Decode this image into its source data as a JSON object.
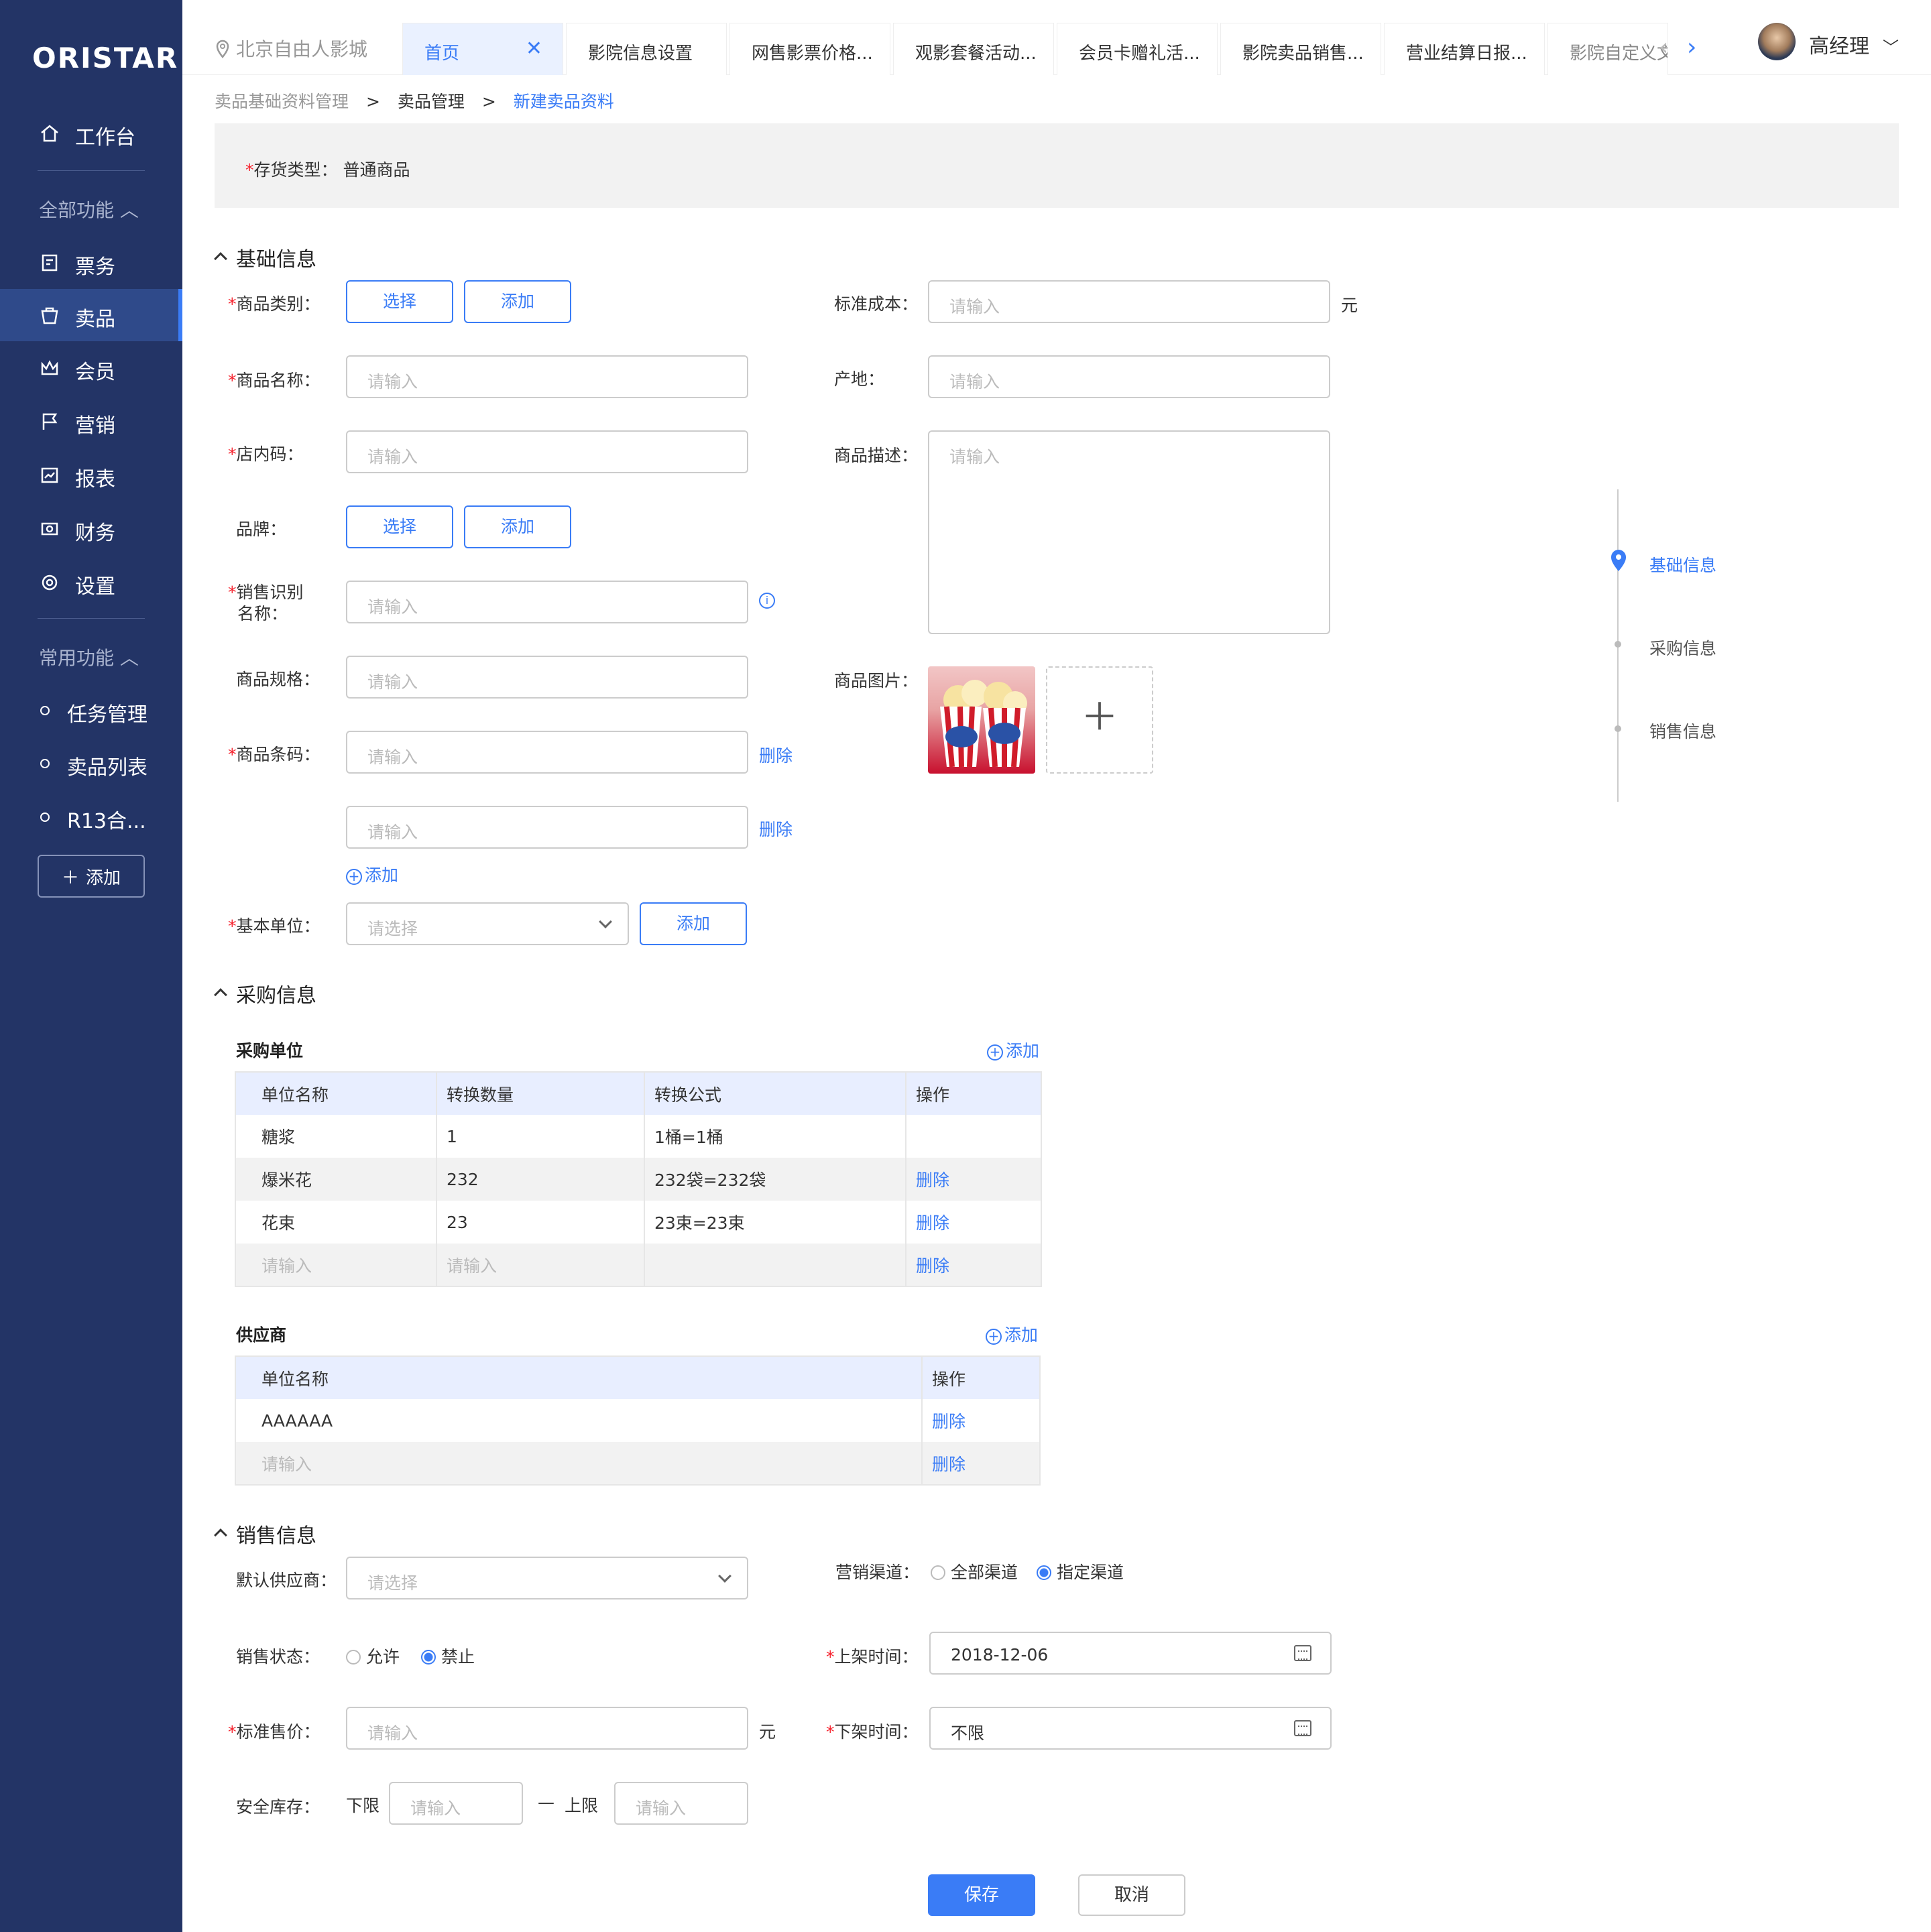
{
  "app": {
    "logo": "ORISTAR"
  },
  "sidebar": {
    "workbench": "工作台",
    "all_functions": "全部功能",
    "items": [
      {
        "label": "票务",
        "icon": "ticket-icon"
      },
      {
        "label": "卖品",
        "icon": "basket-icon"
      },
      {
        "label": "会员",
        "icon": "crown-icon"
      },
      {
        "label": "营销",
        "icon": "flag-icon"
      },
      {
        "label": "报表",
        "icon": "chart-icon"
      },
      {
        "label": "财务",
        "icon": "money-icon"
      },
      {
        "label": "设置",
        "icon": "gear-icon"
      }
    ],
    "common_functions": "常用功能",
    "common_items": [
      "任务管理",
      "卖品列表",
      "R13合..."
    ],
    "add": "添加"
  },
  "topbar": {
    "location": "北京自由人影城",
    "tabs": [
      "首页",
      "影院信息设置",
      "网售影票价格...",
      "观影套餐活动...",
      "会员卡赠礼活...",
      "影院卖品销售...",
      "营业结算日报...",
      "影院自定义文"
    ],
    "user": "高经理"
  },
  "breadcrumb": [
    "卖品基础资料管理",
    ">",
    "卖品管理",
    ">",
    "新建卖品资料"
  ],
  "stock_type": {
    "label": "存货类型：",
    "value": "普通商品"
  },
  "basic": {
    "title": "基础信息",
    "category": "商品类别：",
    "select": "选择",
    "add": "添加",
    "name": "商品名称：",
    "store_code": "店内码：",
    "brand": "品牌：",
    "sale_name_1": "销售识别",
    "sale_name_2": "名称：",
    "spec": "商品规格：",
    "barcode": "商品条码：",
    "delete": "删除",
    "add_link": "添加",
    "base_unit": "基本单位：",
    "select_ph": "请选择",
    "placeholder": "请输入",
    "std_cost": "标准成本：",
    "yuan": "元",
    "origin": "产地：",
    "desc": "商品描述：",
    "image": "商品图片："
  },
  "purchase": {
    "title": "采购信息",
    "unit_title": "采购单位",
    "add": "添加",
    "headers": [
      "单位名称",
      "转换数量",
      "转换公式",
      "操作"
    ],
    "rows": [
      [
        "糖浆",
        "1",
        "1桶=1桶",
        ""
      ],
      [
        "爆米花",
        "232",
        "232袋=232袋",
        "删除"
      ],
      [
        "花束",
        "23",
        "23束=23束",
        "删除"
      ],
      [
        "请输入",
        "请输入",
        "",
        "删除"
      ]
    ],
    "supplier_title": "供应商",
    "sup_headers": [
      "单位名称",
      "操作"
    ],
    "sup_rows": [
      [
        "AAAAAA",
        "删除"
      ],
      [
        "请输入",
        "删除"
      ]
    ]
  },
  "sales": {
    "title": "销售信息",
    "default_supplier": "默认供应商：",
    "select_ph": "请选择",
    "channel": "营销渠道：",
    "all_channel": "全部渠道",
    "spec_channel": "指定渠道",
    "status": "销售状态：",
    "allow": "允许",
    "forbid": "禁止",
    "on_time": "上架时间：",
    "on_time_val": "2018-12-06",
    "price": "标准售价：",
    "yuan": "元",
    "off_time": "下架时间：",
    "off_time_val": "不限",
    "stock": "安全库存：",
    "lower": "下限",
    "upper": "上限",
    "dash": "—",
    "placeholder": "请输入"
  },
  "anchor": [
    "基础信息",
    "采购信息",
    "销售信息"
  ],
  "footer": {
    "save": "保存",
    "cancel": "取消"
  }
}
